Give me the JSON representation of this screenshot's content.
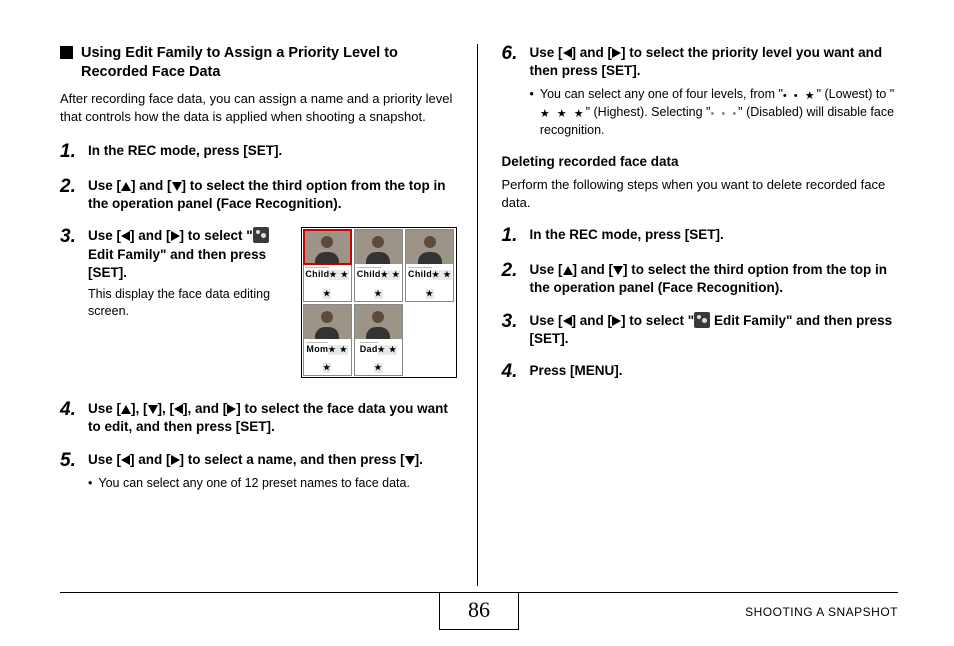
{
  "left": {
    "section_title": "Using Edit Family to Assign a Priority Level to Recorded Face Data",
    "intro": "After recording face data, you can assign a name and a priority level that controls how the data is applied when shooting a snapshot.",
    "steps": {
      "s1": "In the REC mode, press [SET].",
      "s2_a": "Use [",
      "s2_b": "] and [",
      "s2_c": "] to select the third option from the top in the operation panel (Face Recognition).",
      "s3_a": "Use [",
      "s3_b": "] and [",
      "s3_c": "] to select \"",
      "s3_d": " Edit Family\" and then press [SET].",
      "s3_note": "This display the face data editing screen.",
      "s4_a": "Use [",
      "s4_b": "], [",
      "s4_c": "], [",
      "s4_d": "], and [",
      "s4_e": "] to select the face data you want to edit, and then press [SET].",
      "s5_a": "Use [",
      "s5_b": "] and [",
      "s5_c": "] to select a name, and then press [",
      "s5_d": "].",
      "s5_note": "You can select any one of 12 preset names to face data."
    },
    "figure": {
      "row1": [
        {
          "name": "Child",
          "stars": "★ ★ ★"
        },
        {
          "name": "Child",
          "stars": "★ ★ ★"
        },
        {
          "name": "Child",
          "stars": "★ ★ ★"
        }
      ],
      "row2": [
        {
          "name": "Mom",
          "stars": "★ ★ ★"
        },
        {
          "name": "Dad",
          "stars": "★ ★ ★"
        }
      ]
    }
  },
  "right": {
    "s6_a": "Use [",
    "s6_b": "] and [",
    "s6_c": "] to select the priority level you want and then press [SET].",
    "s6_note_a": "You can select any one of four levels, from \"",
    "s6_note_b": "\" (Lowest) to \"",
    "s6_note_c": "\" (Highest). Selecting \"",
    "s6_note_d": "\" (Disabled) will disable face recognition.",
    "rate_low": "• • ★",
    "rate_high": "★ ★ ★",
    "rate_off": "• • •",
    "del_head": "Deleting recorded face data",
    "del_intro": "Perform the following steps when you want to delete recorded face data.",
    "d1": "In the REC mode, press [SET].",
    "d2_a": "Use [",
    "d2_b": "] and [",
    "d2_c": "] to select the third option from the top in the operation panel (Face Recognition).",
    "d3_a": "Use [",
    "d3_b": "] and [",
    "d3_c": "] to select \"",
    "d3_d": " Edit Family\" and then press [SET].",
    "d4": "Press [MENU]."
  },
  "footer": {
    "page": "86",
    "label": "SHOOTING A SNAPSHOT"
  }
}
